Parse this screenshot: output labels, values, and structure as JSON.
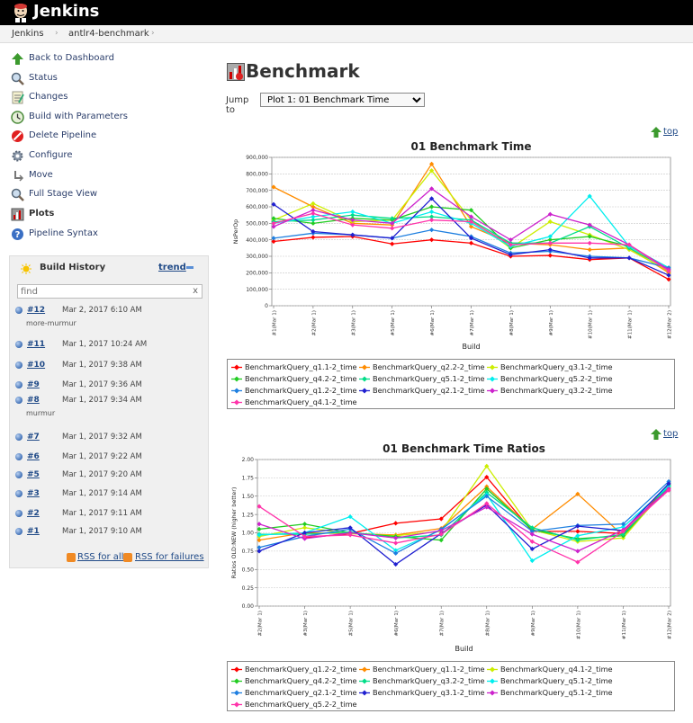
{
  "header": {
    "brand": "Jenkins",
    "logo_icon": "jenkins-butler-icon"
  },
  "breadcrumbs": [
    "Jenkins",
    "antlr4-benchmark"
  ],
  "sidebar": {
    "tasks": [
      {
        "label": "Back to Dashboard",
        "icon": "up-arrow-icon"
      },
      {
        "label": "Status",
        "icon": "magnifier-icon"
      },
      {
        "label": "Changes",
        "icon": "notepad-icon"
      },
      {
        "label": "Build with Parameters",
        "icon": "clock-icon"
      },
      {
        "label": "Delete Pipeline",
        "icon": "no-entry-icon"
      },
      {
        "label": "Configure",
        "icon": "gear-icon"
      },
      {
        "label": "Move",
        "icon": "move-icon"
      },
      {
        "label": "Full Stage View",
        "icon": "magnifier-icon"
      },
      {
        "label": "Plots",
        "icon": "plot-icon"
      },
      {
        "label": "Pipeline Syntax",
        "icon": "help-icon"
      }
    ]
  },
  "build_history": {
    "title": "Build History",
    "trend": "trend",
    "find_placeholder": "find",
    "clear": "x",
    "builds": [
      {
        "num": "#12",
        "date": "Mar 2, 2017 6:10 AM",
        "desc": "more-murmur"
      },
      {
        "num": "#11",
        "date": "Mar 1, 2017 10:24 AM",
        "desc": ""
      },
      {
        "num": "#10",
        "date": "Mar 1, 2017 9:38 AM",
        "desc": ""
      },
      {
        "num": "#9",
        "date": "Mar 1, 2017 9:36 AM",
        "desc": ""
      },
      {
        "num": "#8",
        "date": "Mar 1, 2017 9:34 AM",
        "desc": "murmur"
      },
      {
        "num": "#7",
        "date": "Mar 1, 2017 9:32 AM",
        "desc": ""
      },
      {
        "num": "#6",
        "date": "Mar 1, 2017 9:22 AM",
        "desc": ""
      },
      {
        "num": "#5",
        "date": "Mar 1, 2017 9:20 AM",
        "desc": ""
      },
      {
        "num": "#3",
        "date": "Mar 1, 2017 9:14 AM",
        "desc": ""
      },
      {
        "num": "#2",
        "date": "Mar 1, 2017 9:11 AM",
        "desc": ""
      },
      {
        "num": "#1",
        "date": "Mar 1, 2017 9:10 AM",
        "desc": ""
      }
    ],
    "rss_all": "RSS for all",
    "rss_failures": "RSS for failures"
  },
  "main": {
    "title": "Benchmark",
    "jump_label": "Jump to",
    "jump_value": "Plot 1: 01 Benchmark Time",
    "top_link": "top"
  },
  "chart_data": [
    {
      "type": "line",
      "title": "01 Benchmark Time",
      "xlabel": "Build",
      "ylabel": "NsPerOp",
      "ylim": [
        0,
        900000
      ],
      "yticks": [
        "0",
        "100,000",
        "200,000",
        "300,000",
        "400,000",
        "500,000",
        "600,000",
        "700,000",
        "800,000",
        "900,000"
      ],
      "categories": [
        "#1(Mar 1)",
        "#2(Mar 1)",
        "#3(Mar 1)",
        "#5(Mar 1)",
        "#6(Mar 1)",
        "#7(Mar 1)",
        "#8(Mar 1)",
        "#9(Mar 1)",
        "#10(Mar 1)",
        "#11(Mar 1)",
        "#12(Mar 2)"
      ],
      "grid": true,
      "legend_position": "bottom",
      "series": [
        {
          "name": "BenchmarkQuery_q1.1-2_time",
          "color": "#ff0000",
          "values": [
            390000,
            415000,
            420000,
            375000,
            400000,
            380000,
            300000,
            305000,
            280000,
            290000,
            160000
          ]
        },
        {
          "name": "BenchmarkQuery_q2.2-2_time",
          "color": "#ff8c00",
          "values": [
            720000,
            600000,
            500000,
            490000,
            860000,
            480000,
            380000,
            370000,
            340000,
            350000,
            200000
          ]
        },
        {
          "name": "BenchmarkQuery_q3.1-2_time",
          "color": "#ccee00",
          "values": [
            520000,
            620000,
            510000,
            520000,
            820000,
            520000,
            350000,
            510000,
            430000,
            340000,
            210000
          ]
        },
        {
          "name": "BenchmarkQuery_q4.2-2_time",
          "color": "#22cc22",
          "values": [
            530000,
            500000,
            530000,
            520000,
            600000,
            580000,
            350000,
            400000,
            420000,
            360000,
            230000
          ]
        },
        {
          "name": "BenchmarkQuery_q5.1-2_time",
          "color": "#00dd88",
          "values": [
            510000,
            520000,
            550000,
            530000,
            540000,
            520000,
            380000,
            380000,
            480000,
            350000,
            220000
          ]
        },
        {
          "name": "BenchmarkQuery_q5.2-2_time",
          "color": "#00eeee",
          "values": [
            500000,
            540000,
            570000,
            500000,
            570000,
            500000,
            360000,
            420000,
            665000,
            360000,
            230000
          ]
        },
        {
          "name": "BenchmarkQuery_q1.2-2_time",
          "color": "#1e7fe0",
          "values": [
            410000,
            440000,
            430000,
            410000,
            460000,
            420000,
            320000,
            330000,
            300000,
            290000,
            230000
          ]
        },
        {
          "name": "BenchmarkQuery_q2.1-2_time",
          "color": "#2020d0",
          "values": [
            615000,
            450000,
            430000,
            410000,
            650000,
            410000,
            310000,
            340000,
            290000,
            290000,
            185000
          ]
        },
        {
          "name": "BenchmarkQuery_q3.2-2_time",
          "color": "#cc22cc",
          "values": [
            480000,
            580000,
            520000,
            500000,
            710000,
            540000,
            400000,
            555000,
            490000,
            370000,
            220000
          ]
        },
        {
          "name": "BenchmarkQuery_q4.1-2_time",
          "color": "#ff33aa",
          "values": [
            500000,
            560000,
            490000,
            470000,
            520000,
            510000,
            370000,
            380000,
            380000,
            370000,
            210000
          ]
        }
      ]
    },
    {
      "type": "line",
      "title": "01 Benchmark Time Ratios",
      "xlabel": "Build",
      "ylabel": "Ratios OLD:NEW (higher better)",
      "ylim": [
        0,
        2
      ],
      "yticks": [
        "0.00",
        "0.25",
        "0.50",
        "0.75",
        "1.00",
        "1.25",
        "1.50",
        "1.75",
        "2.00"
      ],
      "categories": [
        "#2(Mar 1)",
        "#3(Mar 1)",
        "#5(Mar 1)",
        "#6(Mar 1)",
        "#7(Mar 1)",
        "#8(Mar 1)",
        "#9(Mar 1)",
        "#10(Mar 1)",
        "#11(Mar 1)",
        "#12(Mar 2)"
      ],
      "grid": true,
      "legend_position": "bottom",
      "series": [
        {
          "name": "BenchmarkQuery_q1.2-2_time",
          "color": "#ff0000",
          "values": [
            0.93,
            0.99,
            1.13,
            1.19,
            1.76,
            1.02,
            1.02,
            0.99,
            1.65
          ]
        },
        {
          "name": "BenchmarkQuery_q1.1-2_time",
          "color": "#ff8c00",
          "values": [
            0.9,
            1.0,
            0.99,
            0.97,
            1.06,
            1.63,
            1.05,
            1.53,
            0.96,
            1.62
          ]
        },
        {
          "name": "BenchmarkQuery_q4.1-2_time",
          "color": "#ccee00",
          "values": [
            0.95,
            1.07,
            0.99,
            0.96,
            1.02,
            1.91,
            1.04,
            0.88,
            0.93,
            1.65
          ]
        },
        {
          "name": "BenchmarkQuery_q4.2-2_time",
          "color": "#22cc22",
          "values": [
            1.05,
            1.12,
            1.0,
            0.95,
            0.9,
            1.6,
            1.04,
            0.92,
            0.96,
            1.65
          ]
        },
        {
          "name": "BenchmarkQuery_q3.2-2_time",
          "color": "#00dd88",
          "values": [
            0.98,
            0.98,
            1.01,
            0.93,
            0.97,
            1.55,
            1.07,
            0.9,
            0.98,
            1.63
          ]
        },
        {
          "name": "BenchmarkQuery_q5.1-2_time",
          "color": "#00eeee",
          "values": [
            0.97,
            1.0,
            1.22,
            0.76,
            1.04,
            1.52,
            0.62,
            0.96,
            1.08,
            1.64
          ]
        },
        {
          "name": "BenchmarkQuery_q2.1-2_time",
          "color": "#1e7fe0",
          "values": [
            0.8,
            0.95,
            1.05,
            0.72,
            1.05,
            1.5,
            1.02,
            1.1,
            1.12,
            1.7
          ]
        },
        {
          "name": "BenchmarkQuery_q3.1-2_time",
          "color": "#2020d0",
          "values": [
            0.75,
            1.0,
            1.07,
            0.57,
            0.99,
            1.38,
            0.78,
            1.09,
            1.03,
            1.67
          ]
        },
        {
          "name": "BenchmarkQuery_q5.1-2_time",
          "color": "#cc22cc",
          "values": [
            1.12,
            0.92,
            1.0,
            0.93,
            1.03,
            1.35,
            0.98,
            0.75,
            1.04,
            1.6
          ]
        },
        {
          "name": "BenchmarkQuery_q5.2-2_time",
          "color": "#ff33aa",
          "values": [
            1.36,
            0.95,
            0.97,
            0.86,
            0.98,
            1.4,
            0.88,
            0.6,
            1.02,
            1.58
          ]
        }
      ]
    }
  ]
}
